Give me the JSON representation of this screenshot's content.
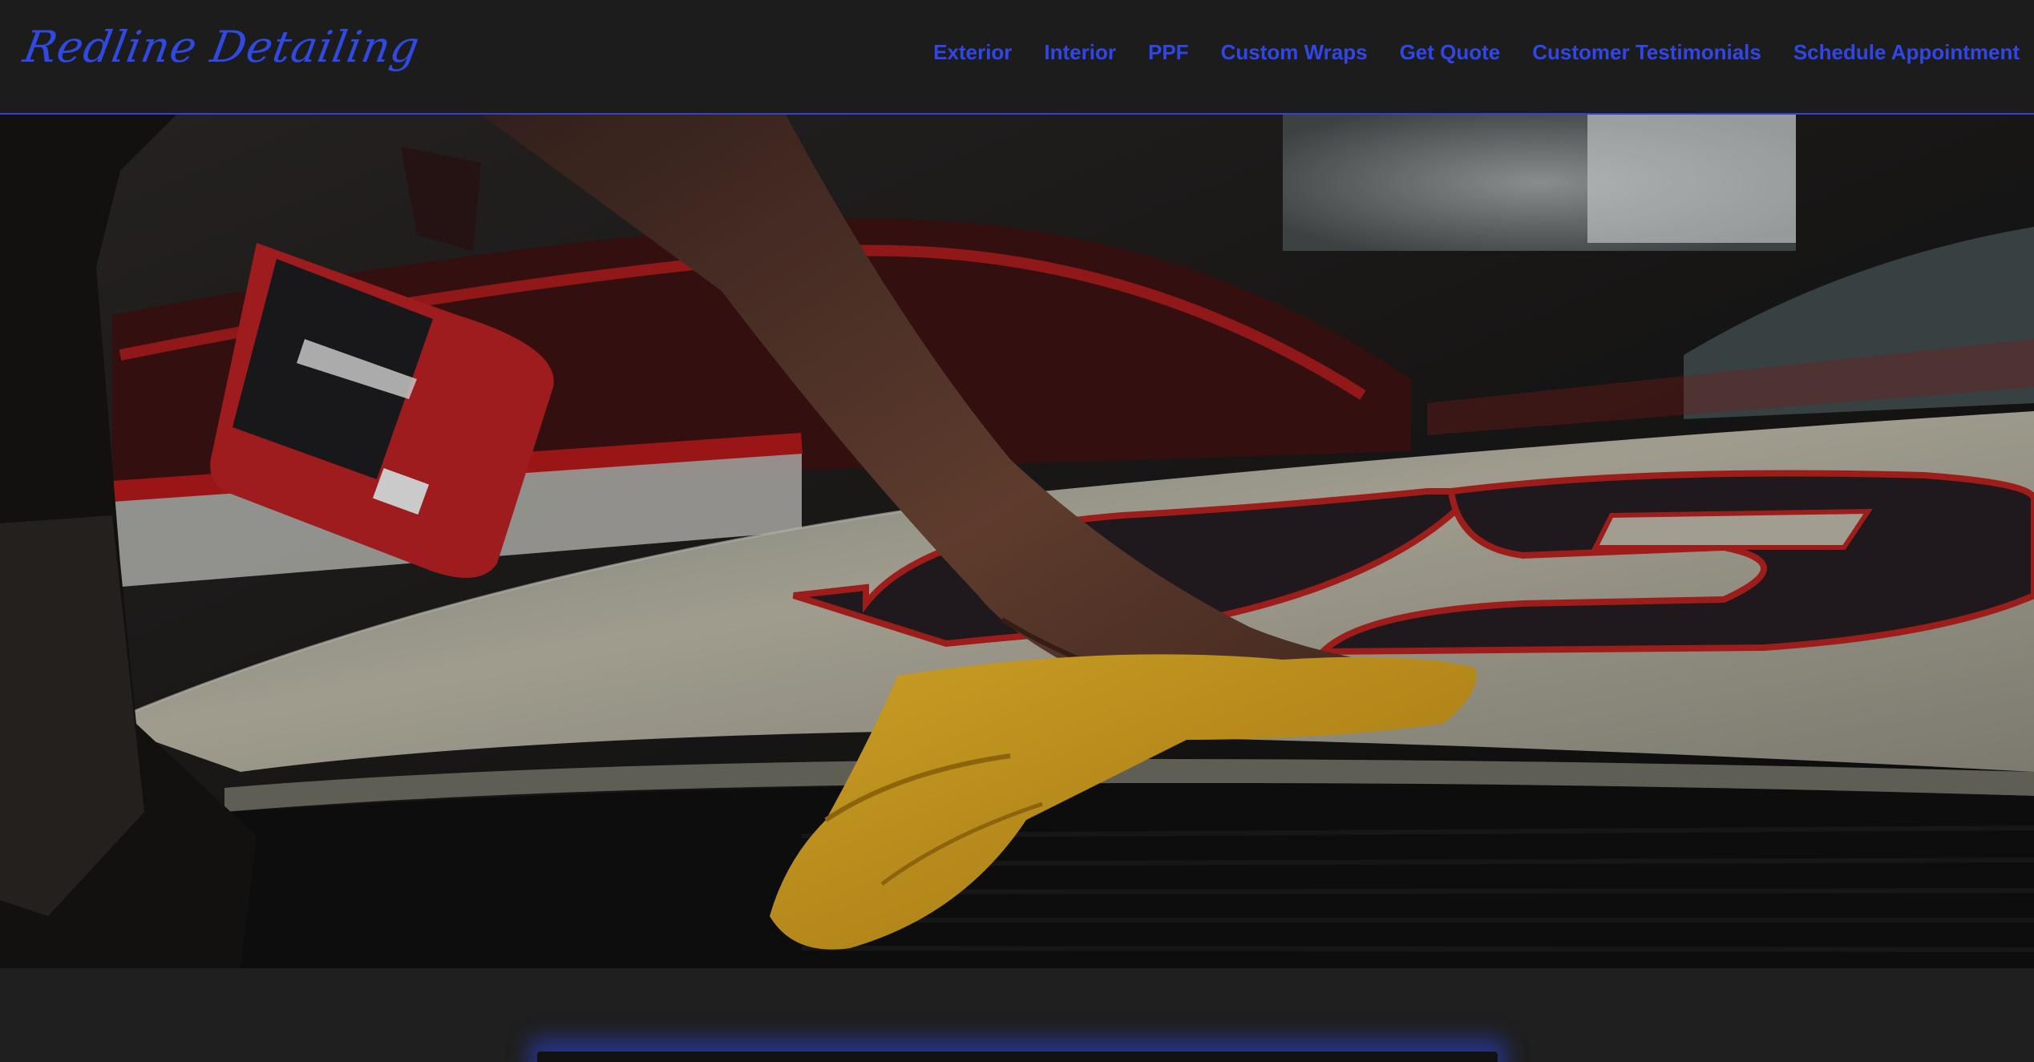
{
  "header": {
    "brand": "Redline Detailing"
  },
  "nav": {
    "items": [
      {
        "label": "Exterior"
      },
      {
        "label": "Interior"
      },
      {
        "label": "PPF"
      },
      {
        "label": "Custom Wraps"
      },
      {
        "label": "Get Quote"
      },
      {
        "label": "Customer Testimonials"
      },
      {
        "label": "Schedule Appointment"
      }
    ]
  },
  "hero": {
    "car_number": "29"
  },
  "colors": {
    "accent": "#3146e6",
    "background": "#1f1f1f",
    "header_bg": "#1c1c1c"
  }
}
